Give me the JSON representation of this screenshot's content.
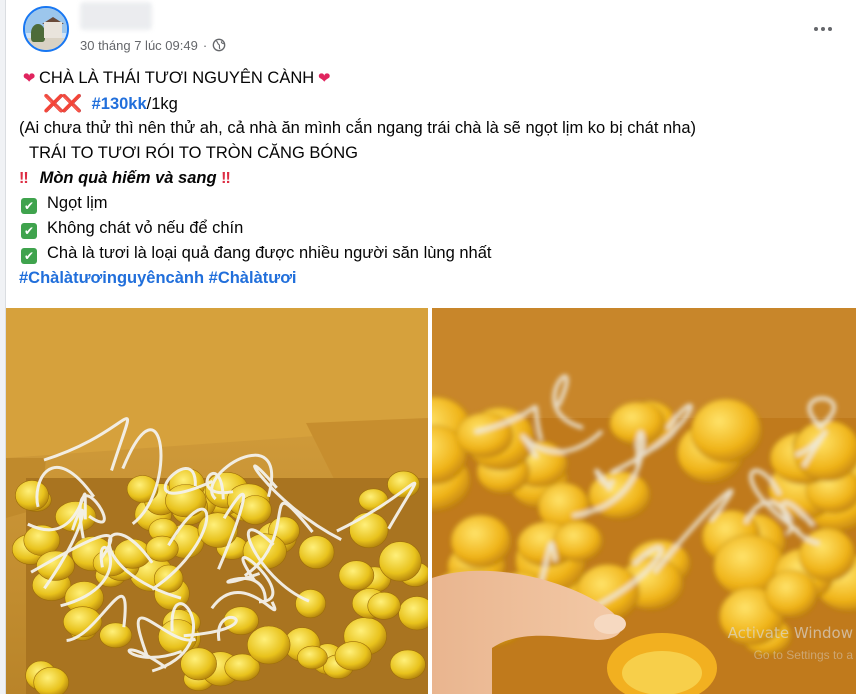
{
  "post": {
    "timestamp": "30 tháng 7 lúc 09:49",
    "audience_icon": "globe-icon",
    "more_icon": "more-horizontal-icon",
    "lines": {
      "title": "CHÀ LÀ THÁI TƯƠI NGUYÊN CÀNH",
      "price_tag": "#130kk",
      "price_unit": "/1kg",
      "note": "(Ai chưa thử thì nên thử ah, cả nhà ăn mình cắn ngang trái chà là sẽ ngọt lịm ko bị chát nha)",
      "caps_line": "TRÁI TO TƯƠI RÓI TO TRÒN CĂNG BÓNG",
      "emphasis": "Mòn quà hiếm và sang",
      "bullets": [
        "Ngọt lịm",
        "Không chát vỏ nếu để chín",
        "Chà là tươi là loại quả đang được nhiều người săn lùng nhất"
      ],
      "hashtag_1": "#Chàlàtươinguyêncành",
      "hashtag_2": "#Chàlàtươi"
    },
    "icons": {
      "heart": "❤",
      "cross": "❌",
      "double_exclamation": "‼",
      "check": "✔"
    }
  },
  "overlay": {
    "watermark_line1": "Activate Window",
    "watermark_line2": "Go to Settings to a"
  },
  "colors": {
    "hashtag": "#216fdb",
    "heart": "#e0245e",
    "check_bg": "#3fa34d",
    "meta_text": "#65676b"
  }
}
